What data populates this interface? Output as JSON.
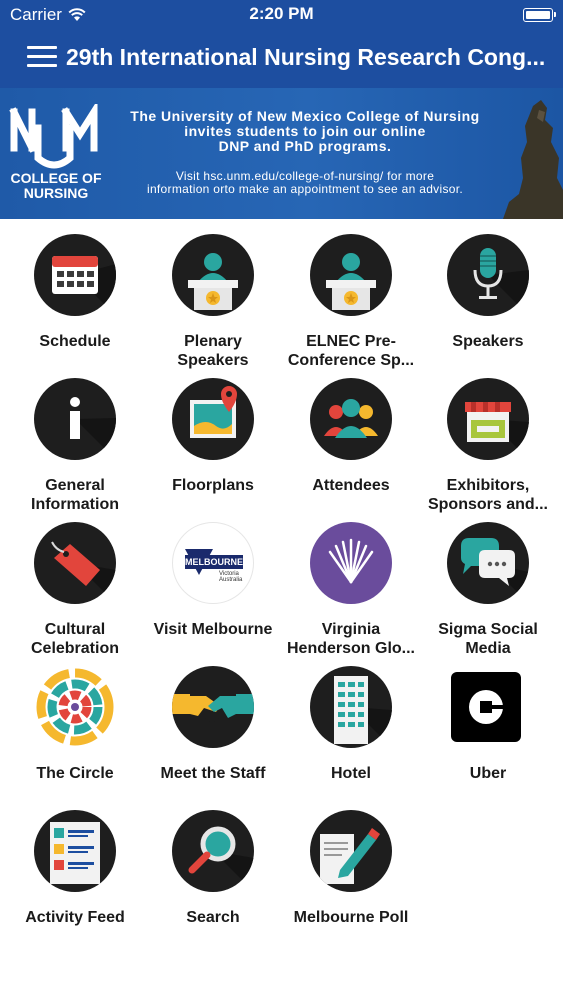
{
  "status_bar": {
    "carrier": "Carrier",
    "time": "2:20 PM"
  },
  "header": {
    "title": "29th International Nursing Research Cong..."
  },
  "banner": {
    "logo_caption_line1": "COLLEGE OF",
    "logo_caption_line2": "NURSING",
    "headline_line1": "The University of New Mexico College of Nursing",
    "headline_line2": "invites students to join our online",
    "headline_line3": "DNP and PhD programs.",
    "visit_line1": "Visit hsc.unm.edu/college-of-nursing/ for more",
    "visit_line2": "information orto make an appointment to see an advisor."
  },
  "tiles": [
    {
      "label_line1": "Schedule",
      "label_line2": "",
      "icon": "calendar-icon"
    },
    {
      "label_line1": "Plenary",
      "label_line2": "Speakers",
      "icon": "podium-speaker-icon"
    },
    {
      "label_line1": "ELNEC Pre-",
      "label_line2": "Conference Sp...",
      "icon": "podium-speaker-icon"
    },
    {
      "label_line1": "Speakers",
      "label_line2": "",
      "icon": "microphone-icon"
    },
    {
      "label_line1": "General",
      "label_line2": "Information",
      "icon": "info-icon"
    },
    {
      "label_line1": "Floorplans",
      "label_line2": "",
      "icon": "map-pin-icon"
    },
    {
      "label_line1": "Attendees",
      "label_line2": "",
      "icon": "people-icon"
    },
    {
      "label_line1": "Exhibitors,",
      "label_line2": "Sponsors and...",
      "icon": "booth-icon"
    },
    {
      "label_line1": "Cultural",
      "label_line2": "Celebration",
      "icon": "tag-icon"
    },
    {
      "label_line1": "Visit Melbourne",
      "label_line2": "",
      "icon": "melbourne-logo"
    },
    {
      "label_line1": "Virginia",
      "label_line2": "Henderson Glo...",
      "icon": "library-fan-icon"
    },
    {
      "label_line1": "Sigma Social",
      "label_line2": "Media",
      "icon": "chat-bubbles-icon"
    },
    {
      "label_line1": "The Circle",
      "label_line2": "",
      "icon": "circle-rings-icon"
    },
    {
      "label_line1": "Meet the Staff",
      "label_line2": "",
      "icon": "handshake-icon"
    },
    {
      "label_line1": "Hotel",
      "label_line2": "",
      "icon": "building-icon"
    },
    {
      "label_line1": "Uber",
      "label_line2": "",
      "icon": "uber-logo"
    },
    {
      "label_line1": "Activity Feed",
      "label_line2": "",
      "icon": "feed-list-icon"
    },
    {
      "label_line1": "Search",
      "label_line2": "",
      "icon": "magnifier-icon"
    },
    {
      "label_line1": "Melbourne Poll",
      "label_line2": "",
      "icon": "poll-pencil-icon"
    }
  ],
  "melbourne_logo": {
    "word": "MELBOURNE",
    "sub1": "Victoria",
    "sub2": "Australia"
  },
  "colors": {
    "header_blue": "#1d4ea0",
    "icon_bg": "#1e1e1e"
  }
}
